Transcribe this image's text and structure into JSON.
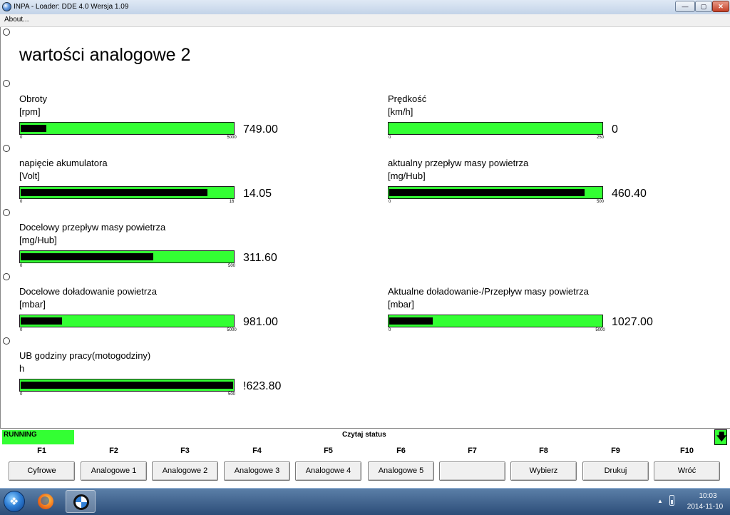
{
  "window": {
    "title": "INPA - Loader:  DDE 4.0 Wersja 1.09",
    "icon": "inpa-app-icon",
    "controls": {
      "minimize": "—",
      "maximize": "▢",
      "close": "✕"
    }
  },
  "menu": {
    "about": "About..."
  },
  "page": {
    "title": "wartości analogowe 2"
  },
  "gauges": [
    {
      "label": "Obroty",
      "unit": "[rpm]",
      "value": "749.00",
      "min": "0",
      "max": "5000",
      "level": 0.12
    },
    {
      "label": "Prędkość",
      "unit": "[km/h]",
      "value": "0",
      "min": "0",
      "max": "250",
      "level": 0
    },
    {
      "label": "napięcie akumulatora",
      "unit": "[Volt]",
      "value": "14.05",
      "min": "0",
      "max": "16",
      "level": 0.878
    },
    {
      "label": "aktualny przepływ masy powietrza",
      "unit": "[mg/Hub]",
      "value": "460.40",
      "min": "0",
      "max": "500",
      "level": 0.921
    },
    {
      "label": "Docelowy przepływ masy powietrza",
      "unit": "[mg/Hub]",
      "value": "311.60",
      "min": "0",
      "max": "500",
      "level": 0.623
    },
    {
      "label": "Docelowe doładowanie powietrza",
      "unit": "[mbar]",
      "value": "981.00",
      "min": "0",
      "max": "5000",
      "level": 0.196
    },
    {
      "label": "Aktualne doładowanie-/Przepływ masy powietrza",
      "unit": "[mbar]",
      "value": "1027.00",
      "min": "0",
      "max": "5000",
      "level": 0.205
    },
    {
      "label": "UB godziny pracy(motogodziny)",
      "unit": "h",
      "value": "!623.80",
      "min": "0",
      "max": "500",
      "level": 1.0
    }
  ],
  "status": {
    "state": "RUNNING",
    "text": "Czytaj status",
    "arrow": "🡇"
  },
  "fkeys": [
    {
      "key": "F1",
      "label": "Cyfrowe"
    },
    {
      "key": "F2",
      "label": "Analogowe 1"
    },
    {
      "key": "F3",
      "label": "Analogowe 2"
    },
    {
      "key": "F4",
      "label": "Analogowe 3"
    },
    {
      "key": "F5",
      "label": "Analogowe 4"
    },
    {
      "key": "F6",
      "label": "Analogowe 5"
    },
    {
      "key": "F7",
      "label": ""
    },
    {
      "key": "F8",
      "label": "Wybierz"
    },
    {
      "key": "F9",
      "label": "Drukuj"
    },
    {
      "key": "F10",
      "label": "Wróć"
    }
  ],
  "taskbar": {
    "start_icon": "windows-start-icon",
    "apps": [
      "firefox-icon",
      "bmw-inpa-icon"
    ],
    "tray_arrow": "▲",
    "time": "10:03",
    "date": "2014-11-10"
  },
  "colors": {
    "bar_bg": "#33ff33",
    "bar_fill": "#000000",
    "running": "#33ff33"
  }
}
